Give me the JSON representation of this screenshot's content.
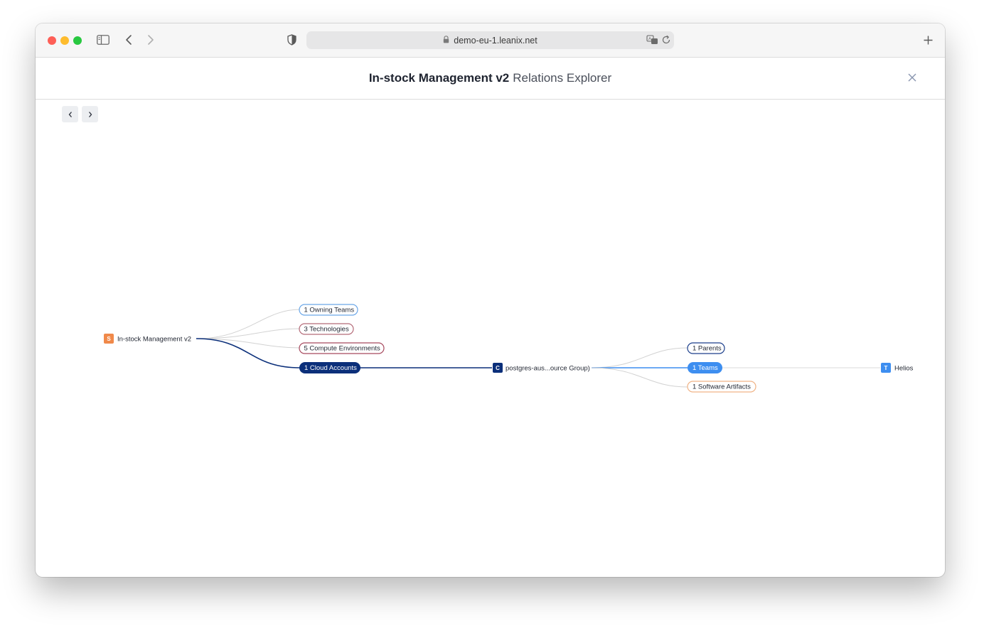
{
  "browser": {
    "url": "demo-eu-1.leanix.net"
  },
  "header": {
    "title_bold": "In-stock Management v2",
    "title_light": "Relations Explorer"
  },
  "graph": {
    "root": {
      "badge": "S",
      "label": "In-stock Management v2",
      "color": "#f0894a"
    },
    "relations": [
      {
        "label": "1 Owning Teams",
        "border": "#6aa6e8",
        "text": "#1f2430"
      },
      {
        "label": "3 Technologies",
        "border": "#b46a78",
        "text": "#1f2430"
      },
      {
        "label": "5 Compute Environments",
        "border": "#a7495e",
        "text": "#1f2430"
      },
      {
        "label": "1 Cloud Accounts",
        "fill": "#0b2f7a",
        "text": "#ffffff",
        "active": true
      }
    ],
    "middle": {
      "badge": "C",
      "label": "postgres-aus...ource Group)",
      "color": "#0b2f7a"
    },
    "sub_relations": [
      {
        "label": "1 Parents",
        "border": "#1c3f8c",
        "text": "#1f2430"
      },
      {
        "label": "1 Teams",
        "fill": "#3d8ef0",
        "text": "#ffffff",
        "active": true
      },
      {
        "label": "1 Software Artifacts",
        "border": "#f0b386",
        "text": "#1f2430"
      }
    ],
    "leaf": {
      "badge": "T",
      "label": "Helios",
      "color": "#3d8ef0"
    }
  },
  "colors": {
    "edge_inactive": "#cfcfcf",
    "edge_active_dark": "#0b2f7a",
    "edge_active_light": "#3d8ef0"
  }
}
